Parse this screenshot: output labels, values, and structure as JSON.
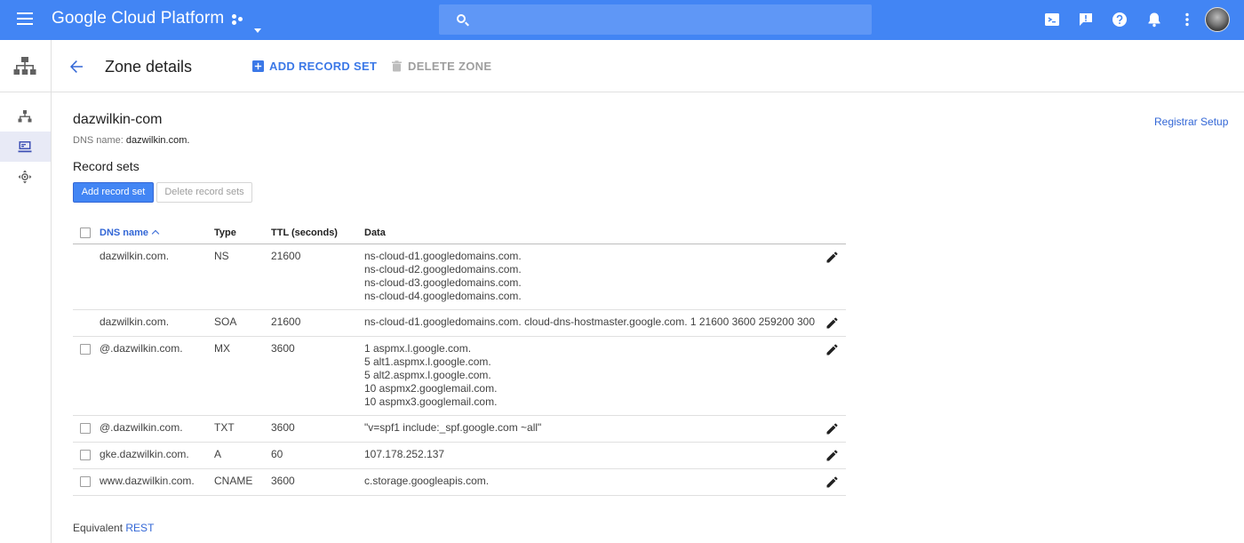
{
  "topbar": {
    "brand": "Google Cloud Platform",
    "icons": [
      "cloud-shell-icon",
      "feedback-icon",
      "help-icon",
      "notifications-icon",
      "more-vert-icon"
    ],
    "color": "#4285f4"
  },
  "header": {
    "title": "Zone details",
    "add_record_set": "ADD RECORD SET",
    "delete_zone": "DELETE ZONE"
  },
  "zone": {
    "name": "dazwilkin-com",
    "dns_name_label": "DNS name:",
    "dns_name_value": "dazwilkin.com.",
    "registrar_setup": "Registrar Setup"
  },
  "record_sets": {
    "title": "Record sets",
    "add_button": "Add record set",
    "delete_button": "Delete record sets",
    "columns": {
      "dns_name": "DNS name",
      "type": "Type",
      "ttl": "TTL (seconds)",
      "data": "Data"
    },
    "rows": [
      {
        "dns_name": "dazwilkin.com.",
        "type": "NS",
        "ttl": "21600",
        "selectable": false,
        "data": [
          "ns-cloud-d1.googledomains.com.",
          "ns-cloud-d2.googledomains.com.",
          "ns-cloud-d3.googledomains.com.",
          "ns-cloud-d4.googledomains.com."
        ]
      },
      {
        "dns_name": "dazwilkin.com.",
        "type": "SOA",
        "ttl": "21600",
        "selectable": false,
        "data": [
          "ns-cloud-d1.googledomains.com. cloud-dns-hostmaster.google.com. 1 21600 3600 259200 300"
        ]
      },
      {
        "dns_name": "@.dazwilkin.com.",
        "type": "MX",
        "ttl": "3600",
        "selectable": true,
        "data": [
          "1 aspmx.l.google.com.",
          "5 alt1.aspmx.l.google.com.",
          "5 alt2.aspmx.l.google.com.",
          "10 aspmx2.googlemail.com.",
          "10 aspmx3.googlemail.com."
        ]
      },
      {
        "dns_name": "@.dazwilkin.com.",
        "type": "TXT",
        "ttl": "3600",
        "selectable": true,
        "data": [
          "\"v=spf1 include:_spf.google.com ~all\""
        ]
      },
      {
        "dns_name": "gke.dazwilkin.com.",
        "type": "A",
        "ttl": "60",
        "selectable": true,
        "data": [
          "107.178.252.137"
        ]
      },
      {
        "dns_name": "www.dazwilkin.com.",
        "type": "CNAME",
        "ttl": "3600",
        "selectable": true,
        "data": [
          "c.storage.googleapis.com."
        ]
      }
    ]
  },
  "footer": {
    "prefix": "Equivalent",
    "link": "REST"
  }
}
